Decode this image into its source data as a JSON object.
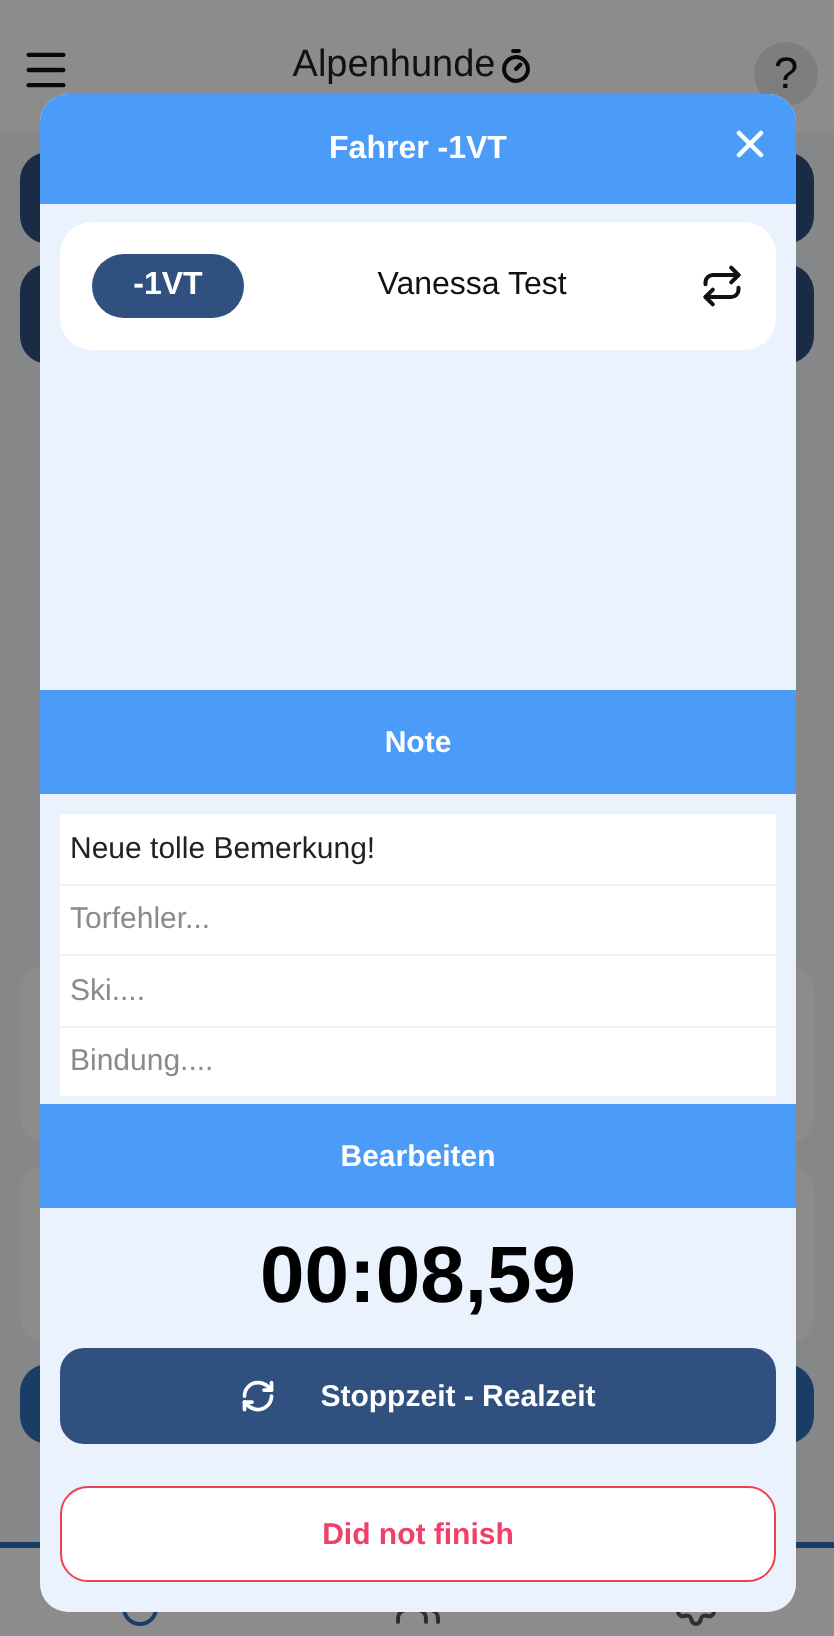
{
  "app_bar": {
    "title": "Alpenhunde",
    "help_label": "?"
  },
  "dialog": {
    "title": "Fahrer -1VT",
    "driver": {
      "bib": "-1VT",
      "name": "Vanessa Test"
    },
    "note_title": "Note",
    "notes": [
      {
        "value": "Neue tolle Bemerkung!"
      },
      {
        "placeholder": "Torfehler..."
      },
      {
        "placeholder": "Ski...."
      },
      {
        "placeholder": "Bindung...."
      }
    ],
    "edit_label": "Bearbeiten",
    "time": "00:08,59",
    "toggle_label": "Stoppzeit - Realzeit",
    "dnf_label": "Did not finish"
  }
}
